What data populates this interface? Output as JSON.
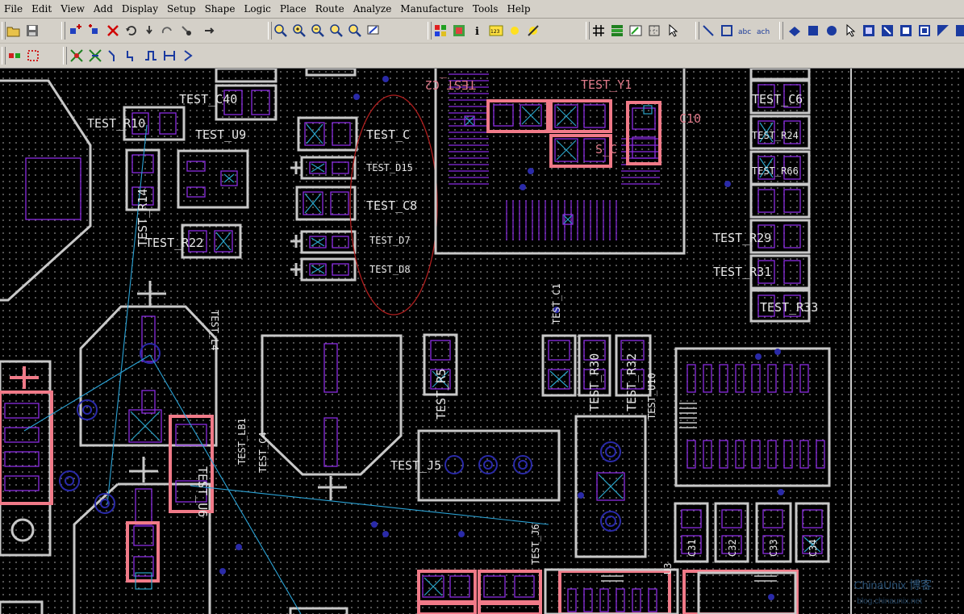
{
  "menu": [
    "File",
    "Edit",
    "View",
    "Add",
    "Display",
    "Setup",
    "Shape",
    "Logic",
    "Place",
    "Route",
    "Analyze",
    "Manufacture",
    "Tools",
    "Help"
  ],
  "toolbar1_icons": [
    "open-file-icon",
    "save-icon",
    "place-part-icon",
    "move-icon",
    "delete-icon",
    "undo-icon",
    "redo-icon",
    "pick-icon",
    "unrats-icon",
    "zoom-fit-icon",
    "zoom-in-icon",
    "zoom-out-icon",
    "zoom-prev-icon",
    "zoom-world-icon",
    "redraw-icon",
    "color-icon",
    "layer-color-icon",
    "info-icon",
    "properties-icon",
    "highlight-icon",
    "dehighlight-icon",
    "grid-icon",
    "layers-icon",
    "text-icon",
    "measure-icon",
    "select-icon",
    "add-line-icon",
    "add-rect-icon",
    "add-text-icon",
    "change-text-icon",
    "shape-icon",
    "fill-shape-icon",
    "circle-shape-icon",
    "void-icon",
    "route-icon",
    "cut-icon",
    "copy-icon",
    "void-rect-icon",
    "last-icon"
  ],
  "toolbar2_icons": [
    "drc-icon",
    "drc-update-icon",
    "ratsnest-icon",
    "route-connect-icon",
    "slide-icon",
    "delay-tune-icon",
    "custom-smooth-icon",
    "spread-icon"
  ],
  "labels": {
    "r10": "TEST_R10",
    "u9": "TEST_U9",
    "c40": "TEST_C40",
    "r14": "TEST_R14",
    "r22": "TEST_R22",
    "c_top": "TEST_C",
    "d15": "TEST_D15",
    "c8": "TEST_C8",
    "d7": "TEST_D7",
    "d8": "TEST_D8",
    "c2": "TEST_C2",
    "y1": "TEST_Y1",
    "c10": "C10",
    "c_mid": "S_C",
    "c6": "TEST_C6",
    "r24": "TEST_R24",
    "r66": "TEST_R66",
    "r29": "TEST_R29",
    "r31": "TEST_R31",
    "r33": "TEST_R33",
    "l4": "TEST_L4",
    "c4": "TEST_C4",
    "lb1": "TEST_LB1",
    "r5": "TEST_R5",
    "r30": "TEST_R30",
    "r32": "TEST_R32",
    "u10": "TEST_U10",
    "c1": "TEST_C1",
    "j5": "TEST_J5",
    "j6": "TEST_J6",
    "u6": "TEST_U6",
    "c31": "C31",
    "c32": "C32",
    "c33": "C33",
    "c34": "C34",
    "u3": "U3"
  },
  "watermark": {
    "line1": "ChinaUnix 博客",
    "line2": "blog.chinaunix.net"
  },
  "colors": {
    "silkscreen": "#c8c8c8",
    "highlight": "#f07a88",
    "pad": "#8a2be2",
    "via": "#2a2aa8",
    "ratsnest": "#2aa3d6",
    "mark_circle": "#b01e1e"
  }
}
